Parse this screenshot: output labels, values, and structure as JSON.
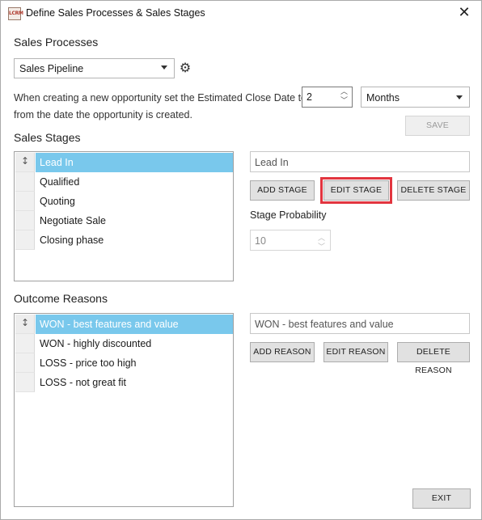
{
  "window": {
    "title": "Define Sales Processes & Sales Stages",
    "app_icon_text": "LCRM",
    "close_symbol": "✕"
  },
  "sales_processes": {
    "heading": "Sales Processes",
    "selected_process": "Sales Pipeline",
    "settings_icon": "gear-icon",
    "close_date_text_line1": "When creating a new opportunity set the Estimated Close Date to",
    "close_date_text_line2": "from the date the opportunity is created.",
    "close_date_value": "2",
    "close_date_unit": "Months",
    "save_label": "SAVE"
  },
  "sales_stages": {
    "heading": "Sales Stages",
    "items": [
      {
        "label": "Lead In",
        "selected": true
      },
      {
        "label": "Qualified",
        "selected": false
      },
      {
        "label": "Quoting",
        "selected": false
      },
      {
        "label": "Negotiate Sale",
        "selected": false
      },
      {
        "label": "Closing phase",
        "selected": false
      }
    ],
    "name_field_value": "Lead In",
    "add_label": "ADD STAGE",
    "edit_label": "EDIT STAGE",
    "delete_label": "DELETE STAGE",
    "probability_label": "Stage Probability",
    "probability_value": "10"
  },
  "outcome_reasons": {
    "heading": "Outcome Reasons",
    "items": [
      {
        "label": "WON - best features and value",
        "selected": true
      },
      {
        "label": "WON - highly discounted",
        "selected": false
      },
      {
        "label": "LOSS - price too high",
        "selected": false
      },
      {
        "label": "LOSS - not great fit",
        "selected": false
      }
    ],
    "name_field_value": "WON - best features and value",
    "add_label": "ADD REASON",
    "edit_label": "EDIT REASON",
    "delete_label": "DELETE REASON"
  },
  "footer": {
    "exit_label": "EXIT"
  },
  "colors": {
    "selection": "#79c8ec",
    "focus_outline": "#e2353f"
  }
}
